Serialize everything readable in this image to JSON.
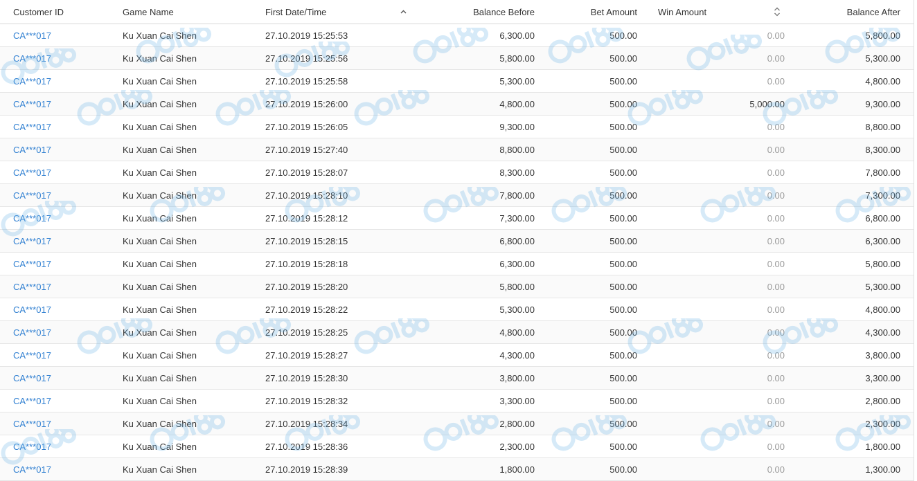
{
  "table": {
    "headers": {
      "customer_id": "Customer ID",
      "game_name": "Game Name",
      "first_datetime": "First Date/Time",
      "balance_before": "Balance Before",
      "bet_amount": "Bet Amount",
      "win_amount": "Win Amount",
      "balance_after": "Balance After"
    },
    "sort_icons": {
      "datetime": "sort-ascending-icon",
      "win_amount": "sort-both-icon"
    },
    "link_color": "#2f7fd1",
    "rows": [
      {
        "customer_id": "CA***017",
        "game_name": "Ku Xuan Cai Shen",
        "datetime": "27.10.2019 15:25:53",
        "balance_before": "6,300.00",
        "bet_amount": "500.00",
        "win_amount": "0.00",
        "balance_after": "5,800.00"
      },
      {
        "customer_id": "CA***017",
        "game_name": "Ku Xuan Cai Shen",
        "datetime": "27.10.2019 15:25:56",
        "balance_before": "5,800.00",
        "bet_amount": "500.00",
        "win_amount": "0.00",
        "balance_after": "5,300.00"
      },
      {
        "customer_id": "CA***017",
        "game_name": "Ku Xuan Cai Shen",
        "datetime": "27.10.2019 15:25:58",
        "balance_before": "5,300.00",
        "bet_amount": "500.00",
        "win_amount": "0.00",
        "balance_after": "4,800.00"
      },
      {
        "customer_id": "CA***017",
        "game_name": "Ku Xuan Cai Shen",
        "datetime": "27.10.2019 15:26:00",
        "balance_before": "4,800.00",
        "bet_amount": "500.00",
        "win_amount": "5,000.00",
        "balance_after": "9,300.00"
      },
      {
        "customer_id": "CA***017",
        "game_name": "Ku Xuan Cai Shen",
        "datetime": "27.10.2019 15:26:05",
        "balance_before": "9,300.00",
        "bet_amount": "500.00",
        "win_amount": "0.00",
        "balance_after": "8,800.00"
      },
      {
        "customer_id": "CA***017",
        "game_name": "Ku Xuan Cai Shen",
        "datetime": "27.10.2019 15:27:40",
        "balance_before": "8,800.00",
        "bet_amount": "500.00",
        "win_amount": "0.00",
        "balance_after": "8,300.00"
      },
      {
        "customer_id": "CA***017",
        "game_name": "Ku Xuan Cai Shen",
        "datetime": "27.10.2019 15:28:07",
        "balance_before": "8,300.00",
        "bet_amount": "500.00",
        "win_amount": "0.00",
        "balance_after": "7,800.00"
      },
      {
        "customer_id": "CA***017",
        "game_name": "Ku Xuan Cai Shen",
        "datetime": "27.10.2019 15:28:10",
        "balance_before": "7,800.00",
        "bet_amount": "500.00",
        "win_amount": "0.00",
        "balance_after": "7,300.00"
      },
      {
        "customer_id": "CA***017",
        "game_name": "Ku Xuan Cai Shen",
        "datetime": "27.10.2019 15:28:12",
        "balance_before": "7,300.00",
        "bet_amount": "500.00",
        "win_amount": "0.00",
        "balance_after": "6,800.00"
      },
      {
        "customer_id": "CA***017",
        "game_name": "Ku Xuan Cai Shen",
        "datetime": "27.10.2019 15:28:15",
        "balance_before": "6,800.00",
        "bet_amount": "500.00",
        "win_amount": "0.00",
        "balance_after": "6,300.00"
      },
      {
        "customer_id": "CA***017",
        "game_name": "Ku Xuan Cai Shen",
        "datetime": "27.10.2019 15:28:18",
        "balance_before": "6,300.00",
        "bet_amount": "500.00",
        "win_amount": "0.00",
        "balance_after": "5,800.00"
      },
      {
        "customer_id": "CA***017",
        "game_name": "Ku Xuan Cai Shen",
        "datetime": "27.10.2019 15:28:20",
        "balance_before": "5,800.00",
        "bet_amount": "500.00",
        "win_amount": "0.00",
        "balance_after": "5,300.00"
      },
      {
        "customer_id": "CA***017",
        "game_name": "Ku Xuan Cai Shen",
        "datetime": "27.10.2019 15:28:22",
        "balance_before": "5,300.00",
        "bet_amount": "500.00",
        "win_amount": "0.00",
        "balance_after": "4,800.00"
      },
      {
        "customer_id": "CA***017",
        "game_name": "Ku Xuan Cai Shen",
        "datetime": "27.10.2019 15:28:25",
        "balance_before": "4,800.00",
        "bet_amount": "500.00",
        "win_amount": "0.00",
        "balance_after": "4,300.00"
      },
      {
        "customer_id": "CA***017",
        "game_name": "Ku Xuan Cai Shen",
        "datetime": "27.10.2019 15:28:27",
        "balance_before": "4,300.00",
        "bet_amount": "500.00",
        "win_amount": "0.00",
        "balance_after": "3,800.00"
      },
      {
        "customer_id": "CA***017",
        "game_name": "Ku Xuan Cai Shen",
        "datetime": "27.10.2019 15:28:30",
        "balance_before": "3,800.00",
        "bet_amount": "500.00",
        "win_amount": "0.00",
        "balance_after": "3,300.00"
      },
      {
        "customer_id": "CA***017",
        "game_name": "Ku Xuan Cai Shen",
        "datetime": "27.10.2019 15:28:32",
        "balance_before": "3,300.00",
        "bet_amount": "500.00",
        "win_amount": "0.00",
        "balance_after": "2,800.00"
      },
      {
        "customer_id": "CA***017",
        "game_name": "Ku Xuan Cai Shen",
        "datetime": "27.10.2019 15:28:34",
        "balance_before": "2,800.00",
        "bet_amount": "500.00",
        "win_amount": "0.00",
        "balance_after": "2,300.00"
      },
      {
        "customer_id": "CA***017",
        "game_name": "Ku Xuan Cai Shen",
        "datetime": "27.10.2019 15:28:36",
        "balance_before": "2,300.00",
        "bet_amount": "500.00",
        "win_amount": "0.00",
        "balance_after": "1,800.00"
      },
      {
        "customer_id": "CA***017",
        "game_name": "Ku Xuan Cai Shen",
        "datetime": "27.10.2019 15:28:39",
        "balance_before": "1,800.00",
        "bet_amount": "500.00",
        "win_amount": "0.00",
        "balance_after": "1,300.00"
      }
    ]
  }
}
